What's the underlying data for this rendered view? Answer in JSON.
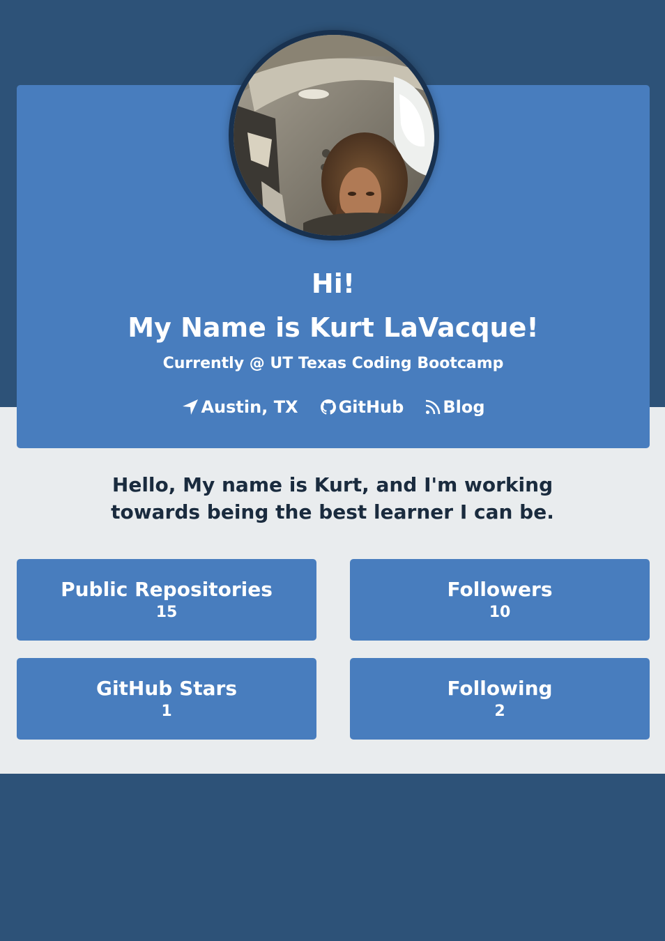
{
  "hero": {
    "greeting": "Hi!",
    "name": "My Name is Kurt LaVacque!",
    "company": "Currently @ UT Texas Coding Bootcamp"
  },
  "links": {
    "location": {
      "label": "Austin, TX",
      "icon": "location-arrow-icon"
    },
    "github": {
      "label": "GitHub",
      "icon": "github-icon"
    },
    "blog": {
      "label": "Blog",
      "icon": "rss-icon"
    }
  },
  "bio": "Hello, My name is Kurt, and I'm working towards being the best learner I can be.",
  "stats": {
    "public_repos": {
      "label": "Public Repositories",
      "value": "15"
    },
    "followers": {
      "label": "Followers",
      "value": "10"
    },
    "stars": {
      "label": "GitHub Stars",
      "value": "1"
    },
    "following": {
      "label": "Following",
      "value": "2"
    }
  },
  "colors": {
    "page_background": "#2d5278",
    "light_section": "#e9ecee",
    "card": "#487dbe",
    "avatar_border": "#18314f",
    "bio_text": "#1a2b3e"
  }
}
